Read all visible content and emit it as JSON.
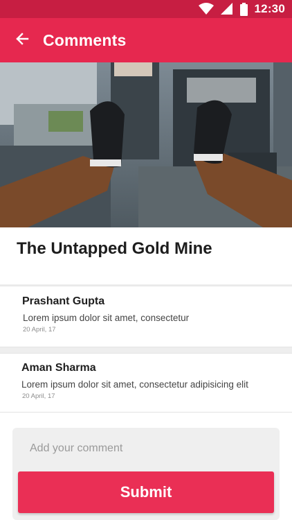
{
  "status_bar": {
    "time": "12:30",
    "icons": [
      "wifi-icon",
      "signal-icon",
      "battery-icon"
    ]
  },
  "app_bar": {
    "title": "Comments",
    "back_icon": "arrow-left-icon",
    "color": "#e6284f"
  },
  "hero_image": {
    "description_icon": "photo"
  },
  "post": {
    "title": "The Untapped Gold Mine"
  },
  "comments": [
    {
      "author": "Prashant Gupta",
      "text": "Lorem ipsum dolor sit amet, consectetur",
      "date": "20 April, 17"
    },
    {
      "author": "Aman Sharma",
      "text": "Lorem ipsum dolor sit amet, consectetur adipisicing elit",
      "date": "20 April, 17"
    }
  ],
  "composer": {
    "placeholder": "Add your comment",
    "submit_label": "Submit",
    "accent": "#ea2f55"
  }
}
